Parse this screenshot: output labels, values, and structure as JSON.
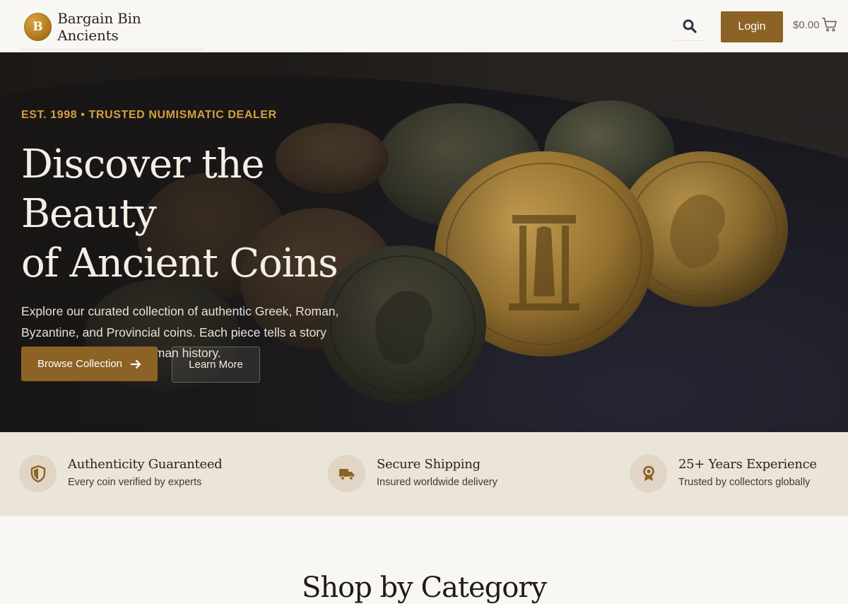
{
  "header": {
    "brand_initial": "B",
    "brand_name": "Bargain Bin Ancients",
    "search_icon": "search-icon",
    "login_label": "Login",
    "cart_total": "$0.00",
    "cart_icon": "shopping-cart-icon"
  },
  "hero": {
    "eyebrow": "EST. 1998 • TRUSTED NUMISMATIC DEALER",
    "title_line1": "Discover the Beauty",
    "title_line2": "of Ancient Coins",
    "description": "Explore our curated collection of authentic Greek, Roman, Byzantine, and Provincial coins. Each piece tells a story spanning millennia of human history.",
    "primary_cta": "Browse Collection",
    "primary_cta_icon": "arrow-right-icon",
    "secondary_cta": "Learn More"
  },
  "features": [
    {
      "icon": "shield-icon",
      "title": "Authenticity Guaranteed",
      "subtitle": "Every coin verified by experts"
    },
    {
      "icon": "truck-icon",
      "title": "Secure Shipping",
      "subtitle": "Insured worldwide delivery"
    },
    {
      "icon": "award-icon",
      "title": "25+ Years Experience",
      "subtitle": "Trusted by collectors globally"
    }
  ],
  "section": {
    "title": "Shop by Category"
  },
  "colors": {
    "accent": "#8c6225",
    "eyebrow": "#d3a03c",
    "page_bg": "#f9f7f4",
    "strip_bg": "#ebe4d8"
  }
}
